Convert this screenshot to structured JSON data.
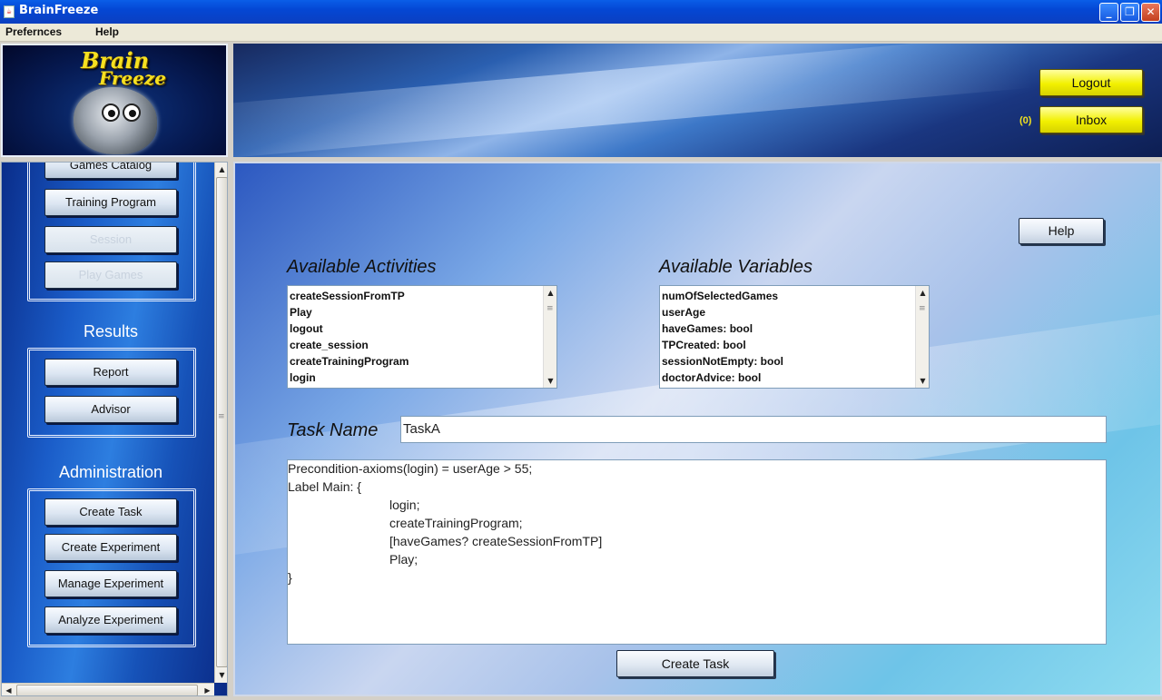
{
  "window": {
    "title": "BrainFreeze",
    "app_icon": "java-cup-icon"
  },
  "menubar": {
    "items": [
      "Prefernces",
      "Help"
    ]
  },
  "header": {
    "logo_text_1": "Brain",
    "logo_text_2": "Freeze",
    "logout_label": "Logout",
    "inbox_label": "Inbox",
    "inbox_count": "(0)"
  },
  "sidebar": {
    "games_catalog": "Games Catalog",
    "training_program": "Training Program",
    "session": "Session",
    "play_games": "Play Games",
    "results_heading": "Results",
    "report": "Report",
    "advisor": "Advisor",
    "admin_heading": "Administration",
    "create_task": "Create Task",
    "create_experiment": "Create Experiment",
    "manage_experiment": "Manage Experiment",
    "analyze_experiment": "Analyze Experiment"
  },
  "main": {
    "help_label": "Help",
    "activities_title": "Available Activities",
    "activities": [
      "createSessionFromTP",
      "Play",
      "logout",
      "create_session",
      "createTrainingProgram",
      "login"
    ],
    "variables_title": "Available Variables",
    "variables": [
      "numOfSelectedGames",
      "userAge",
      "haveGames: bool",
      "TPCreated: bool",
      "sessionNotEmpty: bool",
      "doctorAdvice: bool"
    ],
    "task_name_label": "Task Name",
    "task_name_value": "TaskA",
    "code_lines": [
      "Precondition-axioms(login) = userAge > 55;",
      "Label Main: {",
      "login;",
      "createTrainingProgram;",
      "[haveGames? createSessionFromTP]",
      "Play;",
      "}"
    ],
    "create_task_label": "Create Task"
  },
  "colors": {
    "accent_yellow": "#f2f000",
    "title_bar": "#0447d4"
  }
}
